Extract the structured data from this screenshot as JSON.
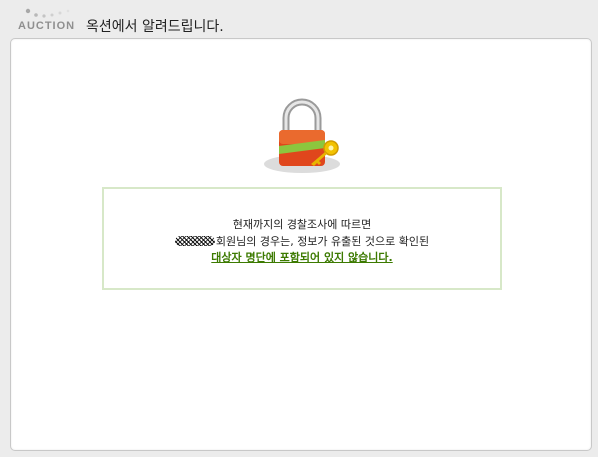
{
  "header": {
    "logo_text": "AUCTION",
    "title": "옥션에서 알려드립니다."
  },
  "icons": {
    "lock": "lock-icon",
    "key": "key-icon"
  },
  "colors": {
    "accent_green": "#3c7a00",
    "box_border": "#d7e8c8",
    "lock_red": "#e0461c"
  },
  "message": {
    "line1": "현재까지의 경찰조사에 따르면",
    "line2": "회원님의 경우는, 정보가 유출된 것으로 확인된",
    "line3": "대상자 명단에 포함되어 있지 않습니다."
  }
}
